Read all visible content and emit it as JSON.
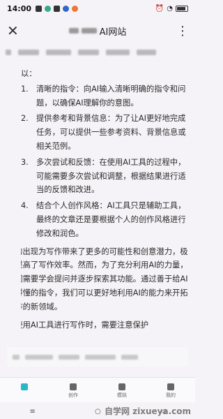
{
  "status_bar": {
    "time": "14:00",
    "battery": ""
  },
  "header": {
    "title_suffix": "AI网站",
    "close_glyph": "✕",
    "more_glyph": "⋮"
  },
  "content": {
    "lead": "以：",
    "steps": [
      {
        "num": "1.",
        "text": "清晰的指令：向AI输入清晰明确的指令和问题，以确保AI理解你的意图。"
      },
      {
        "num": "2.",
        "text": "提供参考和背景信息：为了让AI更好地完成任务，可以提供一些参考资料、背景信息或相关范例。"
      },
      {
        "num": "3.",
        "text": "多次尝试和反馈：在使用AI工具的过程中，可能需要多次尝试和调整，根据结果进行适当的反馈和改进。"
      },
      {
        "num": "4.",
        "text": "结合个人创作风格：AI工具只是辅助工具，最终的文章还是要根据个人的创作风格进行修改和润色。"
      }
    ],
    "paragraphs": [
      "AI的出现为写作带来了更多的可能性和创意潜力，极大提高了写作效率。然而，为了充分利用AI的力量，我们需要学会提问并逐步探索其功能。通过善于给AI看得懂的指令，我们可以更好地利用AI的能力来开拓写作的新领域。",
      "在使用AI工具进行写作时，需要注意保护"
    ]
  },
  "tabs": [
    {
      "label": ""
    },
    {
      "label": "创作"
    },
    {
      "label": "模拟"
    },
    {
      "label": "我的"
    }
  ],
  "nav": {
    "back": "◁",
    "home": "○",
    "menu": "≡"
  },
  "watermark": "自学网 zixueya.com",
  "colors": {
    "accent": "#2bb6c4",
    "background": "#f5f3f7"
  }
}
